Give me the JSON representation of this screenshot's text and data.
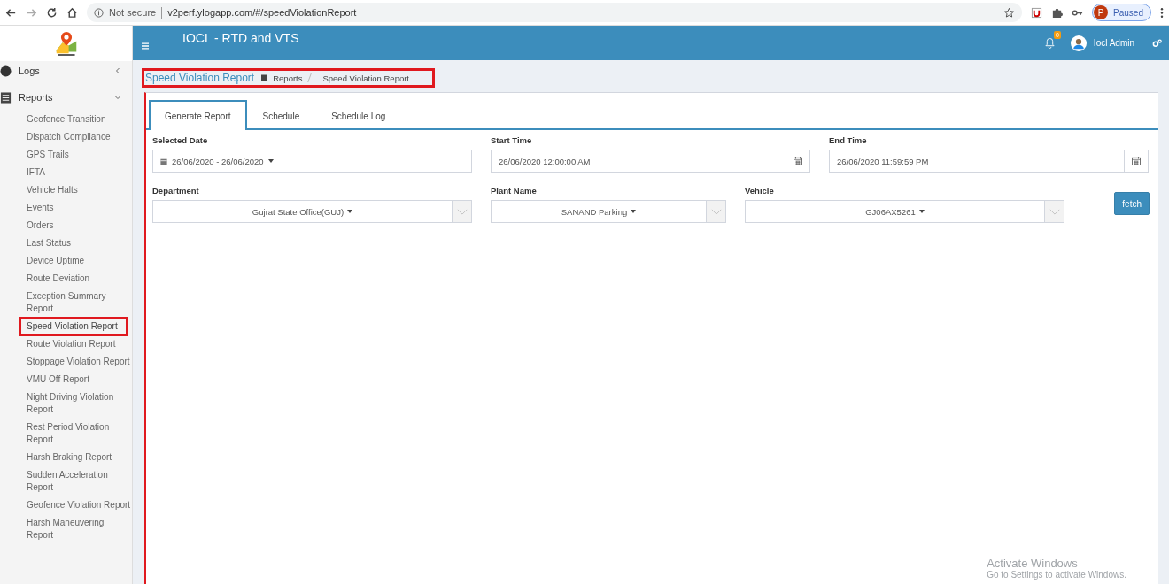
{
  "browser": {
    "security": "Not secure",
    "url": "v2perf.ylogapp.com/#/speedViolationReport",
    "profile_initial": "P",
    "profile_status": "Paused"
  },
  "header": {
    "title": "IOCL - RTD and VTS",
    "notification_count": "0",
    "user": "Iocl Admin"
  },
  "sidebar": {
    "groups": [
      {
        "label": "Logs",
        "expanded": false
      },
      {
        "label": "Reports",
        "expanded": true,
        "items": [
          {
            "label": "Geofence Transition",
            "selected": false
          },
          {
            "label": "Dispatch Compliance",
            "selected": false
          },
          {
            "label": "GPS Trails",
            "selected": false
          },
          {
            "label": "IFTA",
            "selected": false
          },
          {
            "label": "Vehicle Halts",
            "selected": false
          },
          {
            "label": "Events",
            "selected": false
          },
          {
            "label": "Orders",
            "selected": false
          },
          {
            "label": "Last Status",
            "selected": false
          },
          {
            "label": "Device Uptime",
            "selected": false
          },
          {
            "label": "Route Deviation",
            "selected": false
          },
          {
            "label": "Exception Summary Report",
            "selected": false
          },
          {
            "label": "Speed Violation Report",
            "selected": true
          },
          {
            "label": "Route Violation Report",
            "selected": false
          },
          {
            "label": "Stoppage Violation Report",
            "selected": false
          },
          {
            "label": "VMU Off Report",
            "selected": false
          },
          {
            "label": "Night Driving Violation Report",
            "selected": false
          },
          {
            "label": "Rest Period Violation Report",
            "selected": false
          },
          {
            "label": "Harsh Braking Report",
            "selected": false
          },
          {
            "label": "Sudden Acceleration Report",
            "selected": false
          },
          {
            "label": "Geofence Violation Report",
            "selected": false
          },
          {
            "label": "Harsh Maneuvering Report",
            "selected": false
          }
        ]
      }
    ]
  },
  "breadcrumb": {
    "title": "Speed Violation Report",
    "items": [
      "Reports",
      "Speed Violation Report"
    ]
  },
  "tabs": [
    {
      "label": "Generate Report",
      "selected": true
    },
    {
      "label": "Schedule",
      "selected": false
    },
    {
      "label": "Schedule Log",
      "selected": false
    }
  ],
  "form_rows": [
    [
      {
        "kind": "date-range",
        "label": "Selected Date",
        "value": "26/06/2020 - 26/06/2020"
      },
      {
        "kind": "datetime",
        "label": "Start Time",
        "value": "26/06/2020 12:00:00 AM"
      },
      {
        "kind": "datetime",
        "label": "End Time",
        "value": "26/06/2020 11:59:59 PM"
      }
    ],
    [
      {
        "kind": "select",
        "label": "Department",
        "value": "Gujrat State Office(GUJ)"
      },
      {
        "kind": "select",
        "label": "Plant Name",
        "value": "SANAND Parking"
      },
      {
        "kind": "select",
        "label": "Vehicle",
        "value": "GJ06AX5261"
      }
    ]
  ],
  "fetch_button": "fetch",
  "os_notice": {
    "title": "Activate Windows",
    "subtitle": "Go to Settings to activate Windows."
  }
}
